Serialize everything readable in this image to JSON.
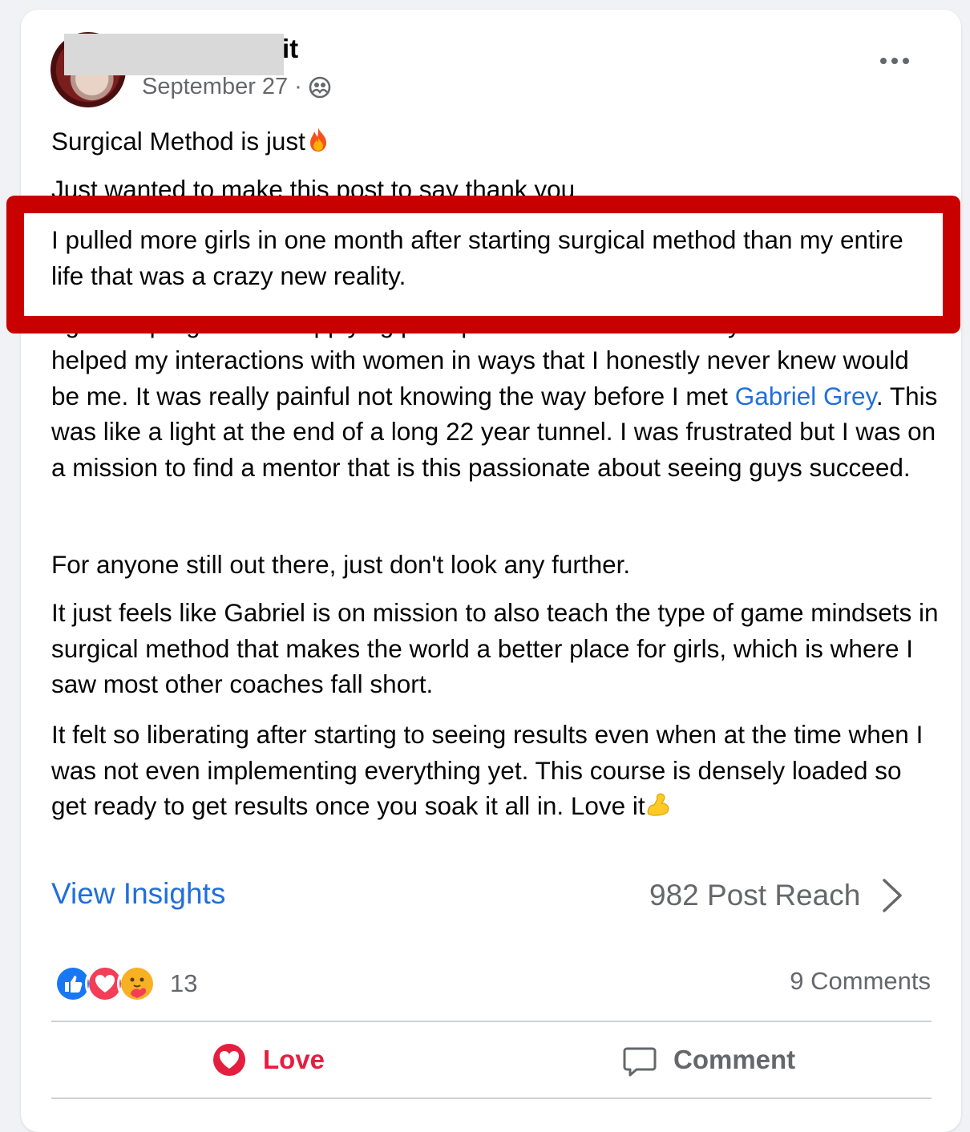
{
  "post": {
    "author_suffix": "it",
    "date": "September 27",
    "separator": "·",
    "privacy_icon": "group-icon",
    "more_icon": "more-horizontal-icon",
    "paragraphs": {
      "p1": "Surgical Method is just",
      "p2": "Just wanted to make this post to say thank you",
      "p3": "I pulled more girls in one month after starting surgical method than my entire life that was a crazy new reality.",
      "p4_line1": "I got the program and applying principles for connection really",
      "p4_before_mention": "helped my interactions with women in ways that I honestly never knew would be me. It was really painful not knowing the way before I met ",
      "p4_mention": "Gabriel Grey",
      "p4_after_mention": ". This was like a light at the end of a long 22 year tunnel. I was frustrated but I was on a mission to find a mentor that is this passionate about seeing guys succeed.",
      "p5": "For anyone still out there, just don't look any further.",
      "p6": "It just feels like Gabriel is on mission to also teach the type of game mindsets in surgical method that makes the world a better place for girls, which is where I saw most other coaches fall short.",
      "p7": "It felt so liberating after starting to seeing results even when at the time when I was not even implementing everything yet. This course is densely loaded so get ready to get results once you soak it all in. Love it"
    },
    "emojis": [
      "fire",
      "flexed-biceps"
    ],
    "highlight_color": "#c80000"
  },
  "insights": {
    "link_label": "View Insights",
    "reach_label": "982 Post Reach"
  },
  "reactions": {
    "types": [
      "like",
      "love",
      "care"
    ],
    "count": "13",
    "comments_label": "9 Comments"
  },
  "actions": {
    "love_label": "Love",
    "comment_label": "Comment"
  },
  "colors": {
    "link": "#216fdb",
    "love": "#e41e3f",
    "secondary": "#65676b"
  }
}
